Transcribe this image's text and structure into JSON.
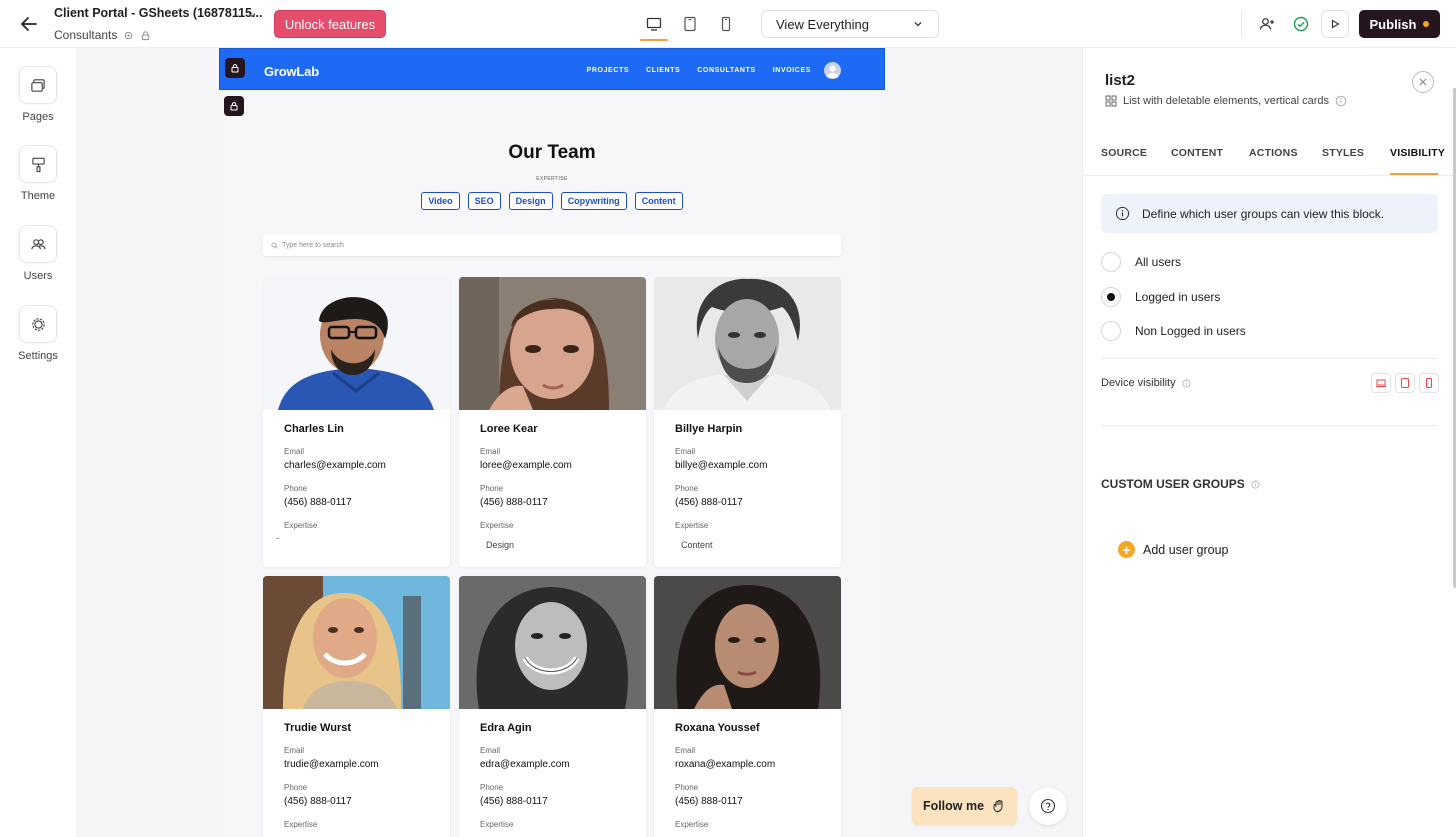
{
  "header": {
    "app_title": "Client Portal - GSheets (16878115...",
    "page_name": "Consultants",
    "unlock_label": "Unlock features",
    "view_select": "View Everything",
    "publish_label": "Publish"
  },
  "sidebar": {
    "items": [
      {
        "label": "Pages",
        "icon": "pages-icon"
      },
      {
        "label": "Theme",
        "icon": "paint-roller-icon"
      },
      {
        "label": "Users",
        "icon": "users-icon"
      },
      {
        "label": "Settings",
        "icon": "gear-icon"
      }
    ]
  },
  "site": {
    "brand": "GrowLab",
    "nav": [
      "PROJECTS",
      "CLIENTS",
      "CONSULTANTS",
      "INVOICES"
    ],
    "title": "Our Team",
    "expertise_label": "EXPERTISE",
    "tags": [
      "Video",
      "SEO",
      "Design",
      "Copywriting",
      "Content"
    ],
    "search_placeholder": "Type here to search",
    "field_labels": {
      "email": "Email",
      "phone": "Phone",
      "expertise": "Expertise"
    },
    "cards": [
      {
        "name": "Charles Lin",
        "email": "charles@example.com",
        "phone": "(456) 888-0117",
        "expertise": "-"
      },
      {
        "name": "Loree Kear",
        "email": "loree@example.com",
        "phone": "(456) 888-0117",
        "expertise": "Design"
      },
      {
        "name": "Billye Harpin",
        "email": "billye@example.com",
        "phone": "(456) 888-0117",
        "expertise": "Content"
      },
      {
        "name": "Trudie Wurst",
        "email": "trudie@example.com",
        "phone": "(456) 888-0117",
        "expertise": ""
      },
      {
        "name": "Edra Agin",
        "email": "edra@example.com",
        "phone": "(456) 888-0117",
        "expertise": ""
      },
      {
        "name": "Roxana Youssef",
        "email": "roxana@example.com",
        "phone": "(456) 888-0117",
        "expertise": ""
      }
    ]
  },
  "panel": {
    "title": "list2",
    "subtitle": "List with deletable elements, vertical cards",
    "tabs": [
      "SOURCE",
      "CONTENT",
      "ACTIONS",
      "STYLES",
      "VISIBILITY"
    ],
    "active_tab": "VISIBILITY",
    "info": "Define which user groups can view this block.",
    "radios": [
      {
        "label": "All users",
        "selected": false
      },
      {
        "label": "Logged in users",
        "selected": true
      },
      {
        "label": "Non Logged in users",
        "selected": false
      }
    ],
    "device_visibility": "Device visibility",
    "custom_groups": "CUSTOM USER GROUPS",
    "add_group": "Add user group"
  },
  "floating": {
    "follow_me": "Follow me"
  },
  "colors": {
    "accent": "#f0a13b",
    "unlock": "#e44d6b",
    "publish": "#24151f",
    "site_nav": "#1f6af4",
    "tag": "#1b4fc7"
  }
}
